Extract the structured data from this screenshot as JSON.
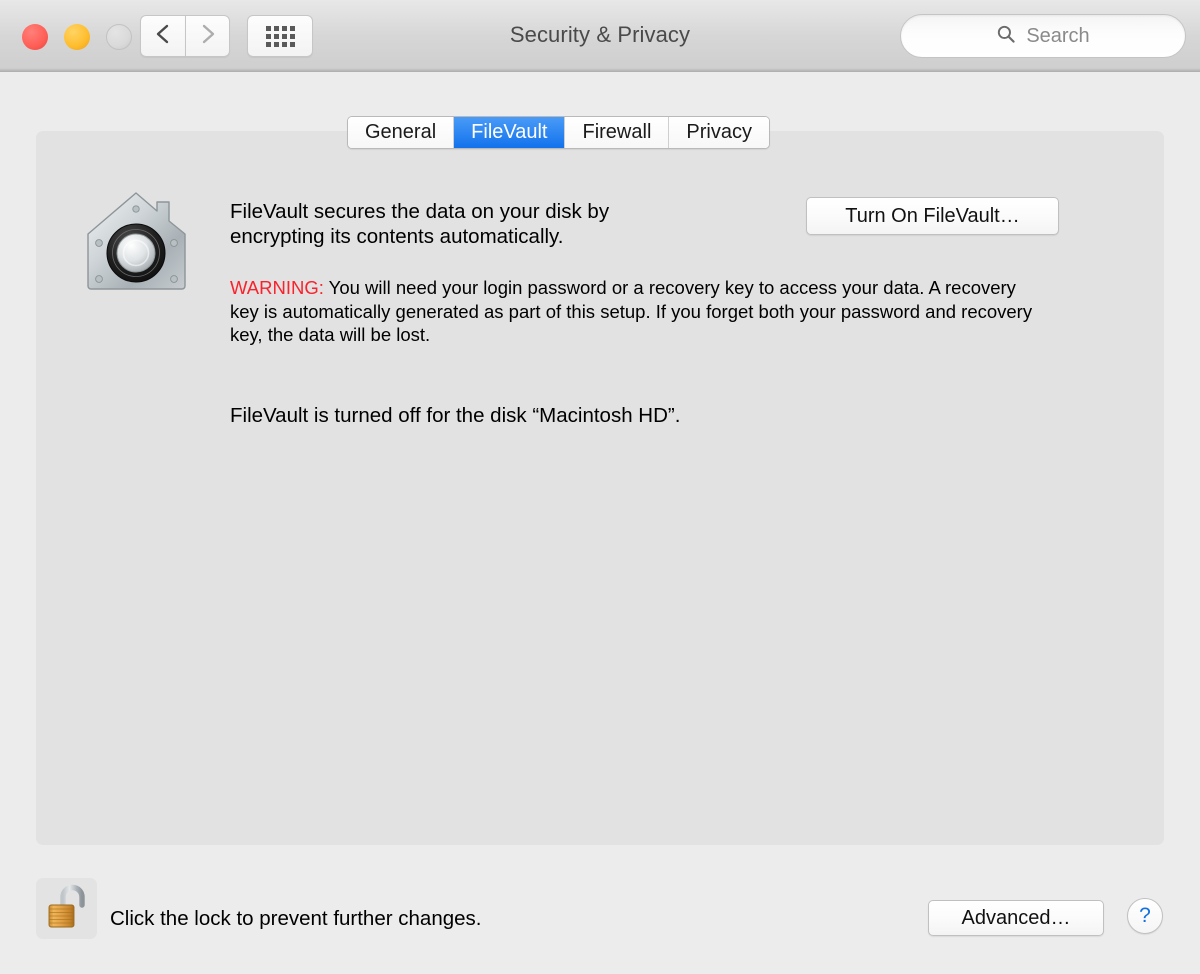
{
  "window": {
    "title": "Security & Privacy",
    "traffic_lights": [
      {
        "name": "close",
        "color": "#ff5f57"
      },
      {
        "name": "minimize",
        "color": "#ffbd2e"
      },
      {
        "name": "zoom",
        "color": "#dadada"
      }
    ],
    "toolbar": {
      "back_icon": "chevron-left-icon",
      "forward_icon": "chevron-right-icon",
      "grid_icon": "show-all-grid-icon"
    },
    "search": {
      "placeholder": "Search",
      "value": "",
      "icon": "search-icon"
    }
  },
  "tabs": [
    {
      "label": "General",
      "selected": false
    },
    {
      "label": "FileVault",
      "selected": true
    },
    {
      "label": "Firewall",
      "selected": false
    },
    {
      "label": "Privacy",
      "selected": false
    }
  ],
  "pane": {
    "icon": "filevault-house-safe-icon",
    "description_line1": "FileVault secures the data on your disk by",
    "description_line2": "encrypting its contents automatically.",
    "warning_label": "WARNING:",
    "warning_text": " You will need your login password or a recovery key to access your data. A recovery key is automatically generated as part of this setup. If you forget both your password and recovery key, the data will be lost.",
    "status": "FileVault is turned off for the disk “Macintosh HD”.",
    "turn_on_button": "Turn On FileVault…"
  },
  "footer": {
    "lock_icon": "unlocked-padlock-icon",
    "lock_caption": "Click the lock to prevent further changes.",
    "advanced_button": "Advanced…",
    "help_button": "?"
  },
  "colors": {
    "accent_blue": "#1272ec",
    "warning_red": "#f8232c",
    "panel_bg": "#e2e2e2",
    "window_bg": "#ececec"
  }
}
